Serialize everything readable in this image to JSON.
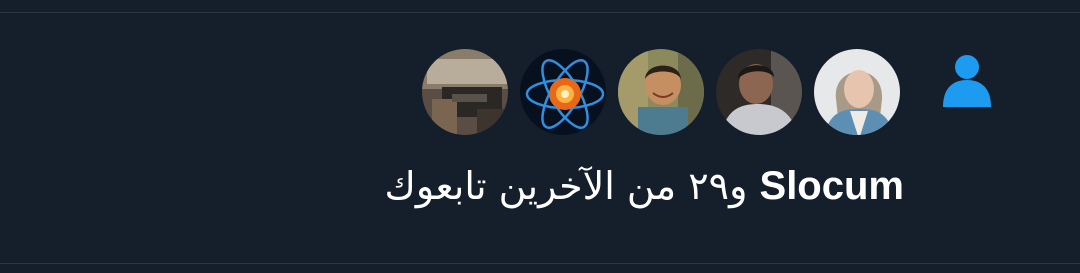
{
  "notification": {
    "type": "follow",
    "name": "Slocum",
    "rest": " و٢٩ من الآخرين تابعوك"
  },
  "icons": {
    "follow_icon": "person-icon"
  },
  "colors": {
    "background": "#151f2b",
    "accent": "#1d9bf0",
    "text": "#ffffff",
    "divider": "#2a3744"
  },
  "avatars": [
    {
      "label": "avatar-1"
    },
    {
      "label": "avatar-2"
    },
    {
      "label": "avatar-3"
    },
    {
      "label": "avatar-4"
    },
    {
      "label": "avatar-5"
    }
  ]
}
